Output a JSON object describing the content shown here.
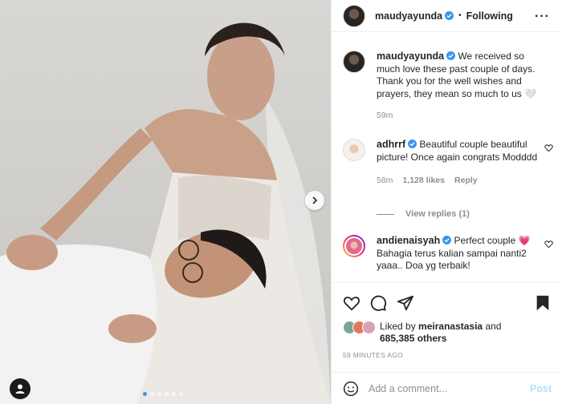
{
  "post": {
    "author": "maudyayunda",
    "follow_status": "Following",
    "separator": "•",
    "more_icon": "more-horizontal-icon",
    "carousel": {
      "slide_count": 6,
      "active_index": 0
    }
  },
  "caption": {
    "username": "maudyayunda",
    "text": "We received so much love these past couple of days. Thank you for the well wishes and prayers, they mean so much to us 🤍",
    "time": "59m"
  },
  "comments": [
    {
      "username": "adhrrf",
      "text": "Beautiful couple beautiful picture! Once again congrats Modddd",
      "time": "58m",
      "likes": "1,128 likes",
      "reply_label": "Reply",
      "view_replies": "View replies (1)"
    },
    {
      "username": "andienaisyah",
      "text": "Perfect couple 💗 Bahagia terus kalian sampai nanti2 yaaa.. Doa yg terbaik!"
    }
  ],
  "actions": {
    "icons": [
      "heart-icon",
      "comment-icon",
      "share-icon",
      "bookmark-icon"
    ]
  },
  "likes": {
    "prefix": "Liked by",
    "user": "meiranastasia",
    "and": "and",
    "others": "685,385 others"
  },
  "timestamp": "59 MINUTES AGO",
  "add_comment": {
    "placeholder": "Add a comment...",
    "post_label": "Post"
  },
  "colors": {
    "verified_blue": "#3897f0",
    "post_button_disabled": "#b2dffc",
    "muted_text": "#8e8e8e",
    "border": "#efefef"
  }
}
